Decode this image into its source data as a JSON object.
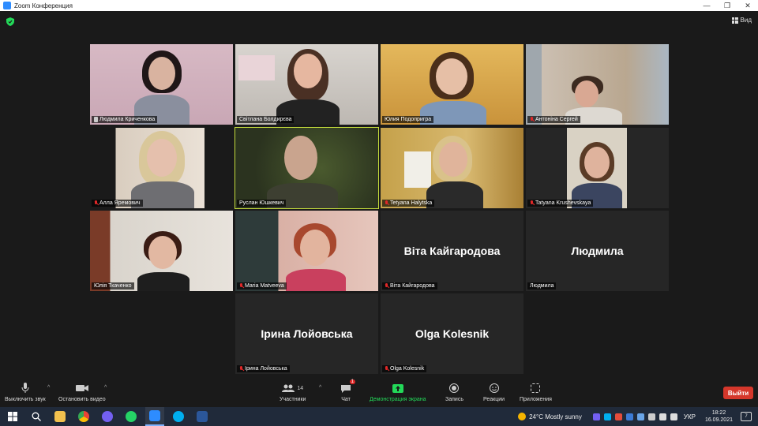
{
  "window": {
    "title": "Zoom Конференция",
    "minimize": "—",
    "restore": "❐",
    "close": "✕"
  },
  "view": {
    "label": "Вид"
  },
  "participants": [
    {
      "name": "Людмила Криченкова",
      "icon": "pin"
    },
    {
      "name": "Світлана Болдирєва",
      "icon": "none"
    },
    {
      "name": "Юлия Подопригра",
      "icon": "none"
    },
    {
      "name": "Антоніна Сергей",
      "icon": "mic-off"
    },
    {
      "name": "Алла Яремович",
      "icon": "mic-off"
    },
    {
      "name": "Руслан Юшкевич",
      "icon": "none"
    },
    {
      "name": "Tetyana Halytska",
      "icon": "mic-off"
    },
    {
      "name": "Tatyana Krushevskaya",
      "icon": "mic-off"
    },
    {
      "name": "Юлія Ткаченко",
      "icon": "none"
    },
    {
      "name": "Maria Matveeva",
      "icon": "mic-off"
    },
    {
      "name": "Віта Кайгародова",
      "display": "Віта Кайгародова",
      "icon": "mic-off"
    },
    {
      "name": "Людмила",
      "display": "Людмила",
      "icon": "none"
    },
    {
      "name": "Ірина Лойовська",
      "display": "Ірина Лойовська",
      "icon": "mic-off"
    },
    {
      "name": "Olga Kolesnik",
      "display": "Olga Kolesnik",
      "icon": "mic-off"
    }
  ],
  "toolbar": {
    "mute": "Выключить звук",
    "stop_video": "Остановить видео",
    "participants": "Участники",
    "participants_count": "14",
    "chat": "Чат",
    "chat_badge": "1",
    "share": "Демонстрация экрана",
    "record": "Запись",
    "reactions": "Реакции",
    "apps": "Приложения",
    "leave": "Выйти"
  },
  "taskbar": {
    "weather": "24°C  Mostly sunny",
    "language": "УКР",
    "time": "18:22",
    "date": "16.09.2021",
    "notifications": "7"
  },
  "colors": {
    "active_speaker": "#c4dc3c",
    "leave": "#d5372b",
    "share": "#23d959"
  }
}
